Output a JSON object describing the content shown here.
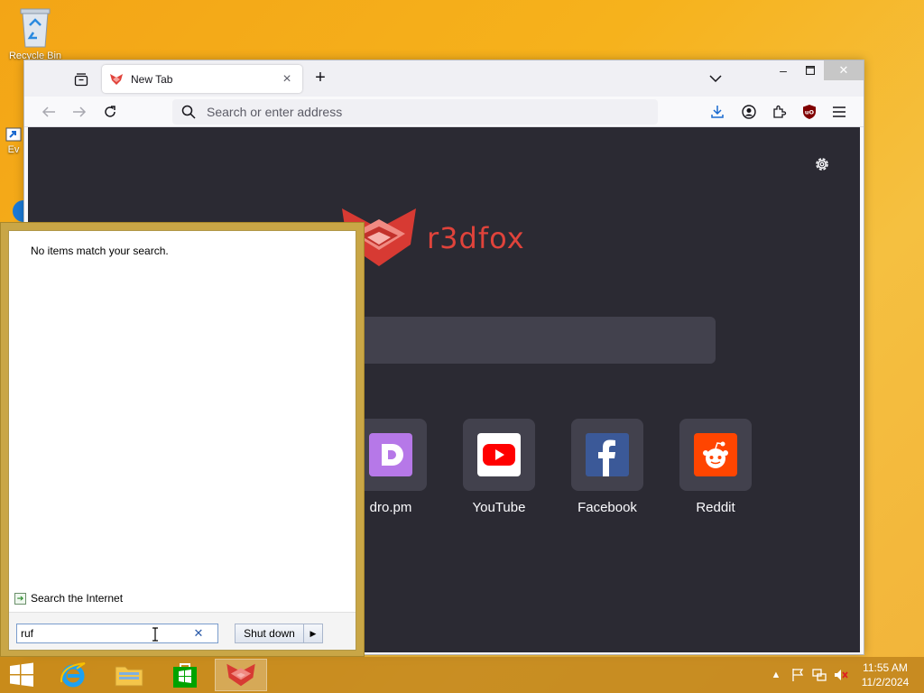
{
  "desktop": {
    "icons": [
      {
        "label": "Recycle Bin"
      },
      {
        "label": "Ev"
      }
    ]
  },
  "browser": {
    "tab": {
      "title": "New Tab"
    },
    "urlbar": {
      "placeholder": "Search or enter address"
    },
    "wordmark": "r3dfox",
    "shortcuts": [
      {
        "label": "dro.pm",
        "icon": "dropm-icon"
      },
      {
        "label": "YouTube",
        "icon": "youtube-icon"
      },
      {
        "label": "Facebook",
        "icon": "facebook-icon"
      },
      {
        "label": "Reddit",
        "icon": "reddit-icon"
      }
    ],
    "colors": {
      "accent": "#e0433b",
      "content_bg": "#2b2a33",
      "tile_bg": "#42414d"
    }
  },
  "start_menu": {
    "message": "No items match your search.",
    "search_internet": "Search the Internet",
    "search_value": "ruf",
    "shutdown_label": "Shut down"
  },
  "taskbar": {
    "clock_time": "11:55 AM",
    "clock_date": "11/2/2024"
  }
}
